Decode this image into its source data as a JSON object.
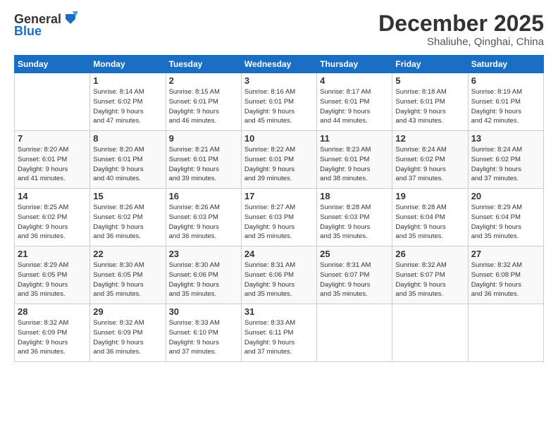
{
  "header": {
    "logo_line1": "General",
    "logo_line2": "Blue",
    "month_year": "December 2025",
    "location": "Shaliuhe, Qinghai, China"
  },
  "days_of_week": [
    "Sunday",
    "Monday",
    "Tuesday",
    "Wednesday",
    "Thursday",
    "Friday",
    "Saturday"
  ],
  "weeks": [
    [
      {
        "day": "",
        "info": ""
      },
      {
        "day": "1",
        "info": "Sunrise: 8:14 AM\nSunset: 6:02 PM\nDaylight: 9 hours\nand 47 minutes."
      },
      {
        "day": "2",
        "info": "Sunrise: 8:15 AM\nSunset: 6:01 PM\nDaylight: 9 hours\nand 46 minutes."
      },
      {
        "day": "3",
        "info": "Sunrise: 8:16 AM\nSunset: 6:01 PM\nDaylight: 9 hours\nand 45 minutes."
      },
      {
        "day": "4",
        "info": "Sunrise: 8:17 AM\nSunset: 6:01 PM\nDaylight: 9 hours\nand 44 minutes."
      },
      {
        "day": "5",
        "info": "Sunrise: 8:18 AM\nSunset: 6:01 PM\nDaylight: 9 hours\nand 43 minutes."
      },
      {
        "day": "6",
        "info": "Sunrise: 8:19 AM\nSunset: 6:01 PM\nDaylight: 9 hours\nand 42 minutes."
      }
    ],
    [
      {
        "day": "7",
        "info": "Sunrise: 8:20 AM\nSunset: 6:01 PM\nDaylight: 9 hours\nand 41 minutes."
      },
      {
        "day": "8",
        "info": "Sunrise: 8:20 AM\nSunset: 6:01 PM\nDaylight: 9 hours\nand 40 minutes."
      },
      {
        "day": "9",
        "info": "Sunrise: 8:21 AM\nSunset: 6:01 PM\nDaylight: 9 hours\nand 39 minutes."
      },
      {
        "day": "10",
        "info": "Sunrise: 8:22 AM\nSunset: 6:01 PM\nDaylight: 9 hours\nand 39 minutes."
      },
      {
        "day": "11",
        "info": "Sunrise: 8:23 AM\nSunset: 6:01 PM\nDaylight: 9 hours\nand 38 minutes."
      },
      {
        "day": "12",
        "info": "Sunrise: 8:24 AM\nSunset: 6:02 PM\nDaylight: 9 hours\nand 37 minutes."
      },
      {
        "day": "13",
        "info": "Sunrise: 8:24 AM\nSunset: 6:02 PM\nDaylight: 9 hours\nand 37 minutes."
      }
    ],
    [
      {
        "day": "14",
        "info": "Sunrise: 8:25 AM\nSunset: 6:02 PM\nDaylight: 9 hours\nand 36 minutes."
      },
      {
        "day": "15",
        "info": "Sunrise: 8:26 AM\nSunset: 6:02 PM\nDaylight: 9 hours\nand 36 minutes."
      },
      {
        "day": "16",
        "info": "Sunrise: 8:26 AM\nSunset: 6:03 PM\nDaylight: 9 hours\nand 36 minutes."
      },
      {
        "day": "17",
        "info": "Sunrise: 8:27 AM\nSunset: 6:03 PM\nDaylight: 9 hours\nand 35 minutes."
      },
      {
        "day": "18",
        "info": "Sunrise: 8:28 AM\nSunset: 6:03 PM\nDaylight: 9 hours\nand 35 minutes."
      },
      {
        "day": "19",
        "info": "Sunrise: 8:28 AM\nSunset: 6:04 PM\nDaylight: 9 hours\nand 35 minutes."
      },
      {
        "day": "20",
        "info": "Sunrise: 8:29 AM\nSunset: 6:04 PM\nDaylight: 9 hours\nand 35 minutes."
      }
    ],
    [
      {
        "day": "21",
        "info": "Sunrise: 8:29 AM\nSunset: 6:05 PM\nDaylight: 9 hours\nand 35 minutes."
      },
      {
        "day": "22",
        "info": "Sunrise: 8:30 AM\nSunset: 6:05 PM\nDaylight: 9 hours\nand 35 minutes."
      },
      {
        "day": "23",
        "info": "Sunrise: 8:30 AM\nSunset: 6:06 PM\nDaylight: 9 hours\nand 35 minutes."
      },
      {
        "day": "24",
        "info": "Sunrise: 8:31 AM\nSunset: 6:06 PM\nDaylight: 9 hours\nand 35 minutes."
      },
      {
        "day": "25",
        "info": "Sunrise: 8:31 AM\nSunset: 6:07 PM\nDaylight: 9 hours\nand 35 minutes."
      },
      {
        "day": "26",
        "info": "Sunrise: 8:32 AM\nSunset: 6:07 PM\nDaylight: 9 hours\nand 35 minutes."
      },
      {
        "day": "27",
        "info": "Sunrise: 8:32 AM\nSunset: 6:08 PM\nDaylight: 9 hours\nand 36 minutes."
      }
    ],
    [
      {
        "day": "28",
        "info": "Sunrise: 8:32 AM\nSunset: 6:09 PM\nDaylight: 9 hours\nand 36 minutes."
      },
      {
        "day": "29",
        "info": "Sunrise: 8:32 AM\nSunset: 6:09 PM\nDaylight: 9 hours\nand 36 minutes."
      },
      {
        "day": "30",
        "info": "Sunrise: 8:33 AM\nSunset: 6:10 PM\nDaylight: 9 hours\nand 37 minutes."
      },
      {
        "day": "31",
        "info": "Sunrise: 8:33 AM\nSunset: 6:11 PM\nDaylight: 9 hours\nand 37 minutes."
      },
      {
        "day": "",
        "info": ""
      },
      {
        "day": "",
        "info": ""
      },
      {
        "day": "",
        "info": ""
      }
    ]
  ]
}
